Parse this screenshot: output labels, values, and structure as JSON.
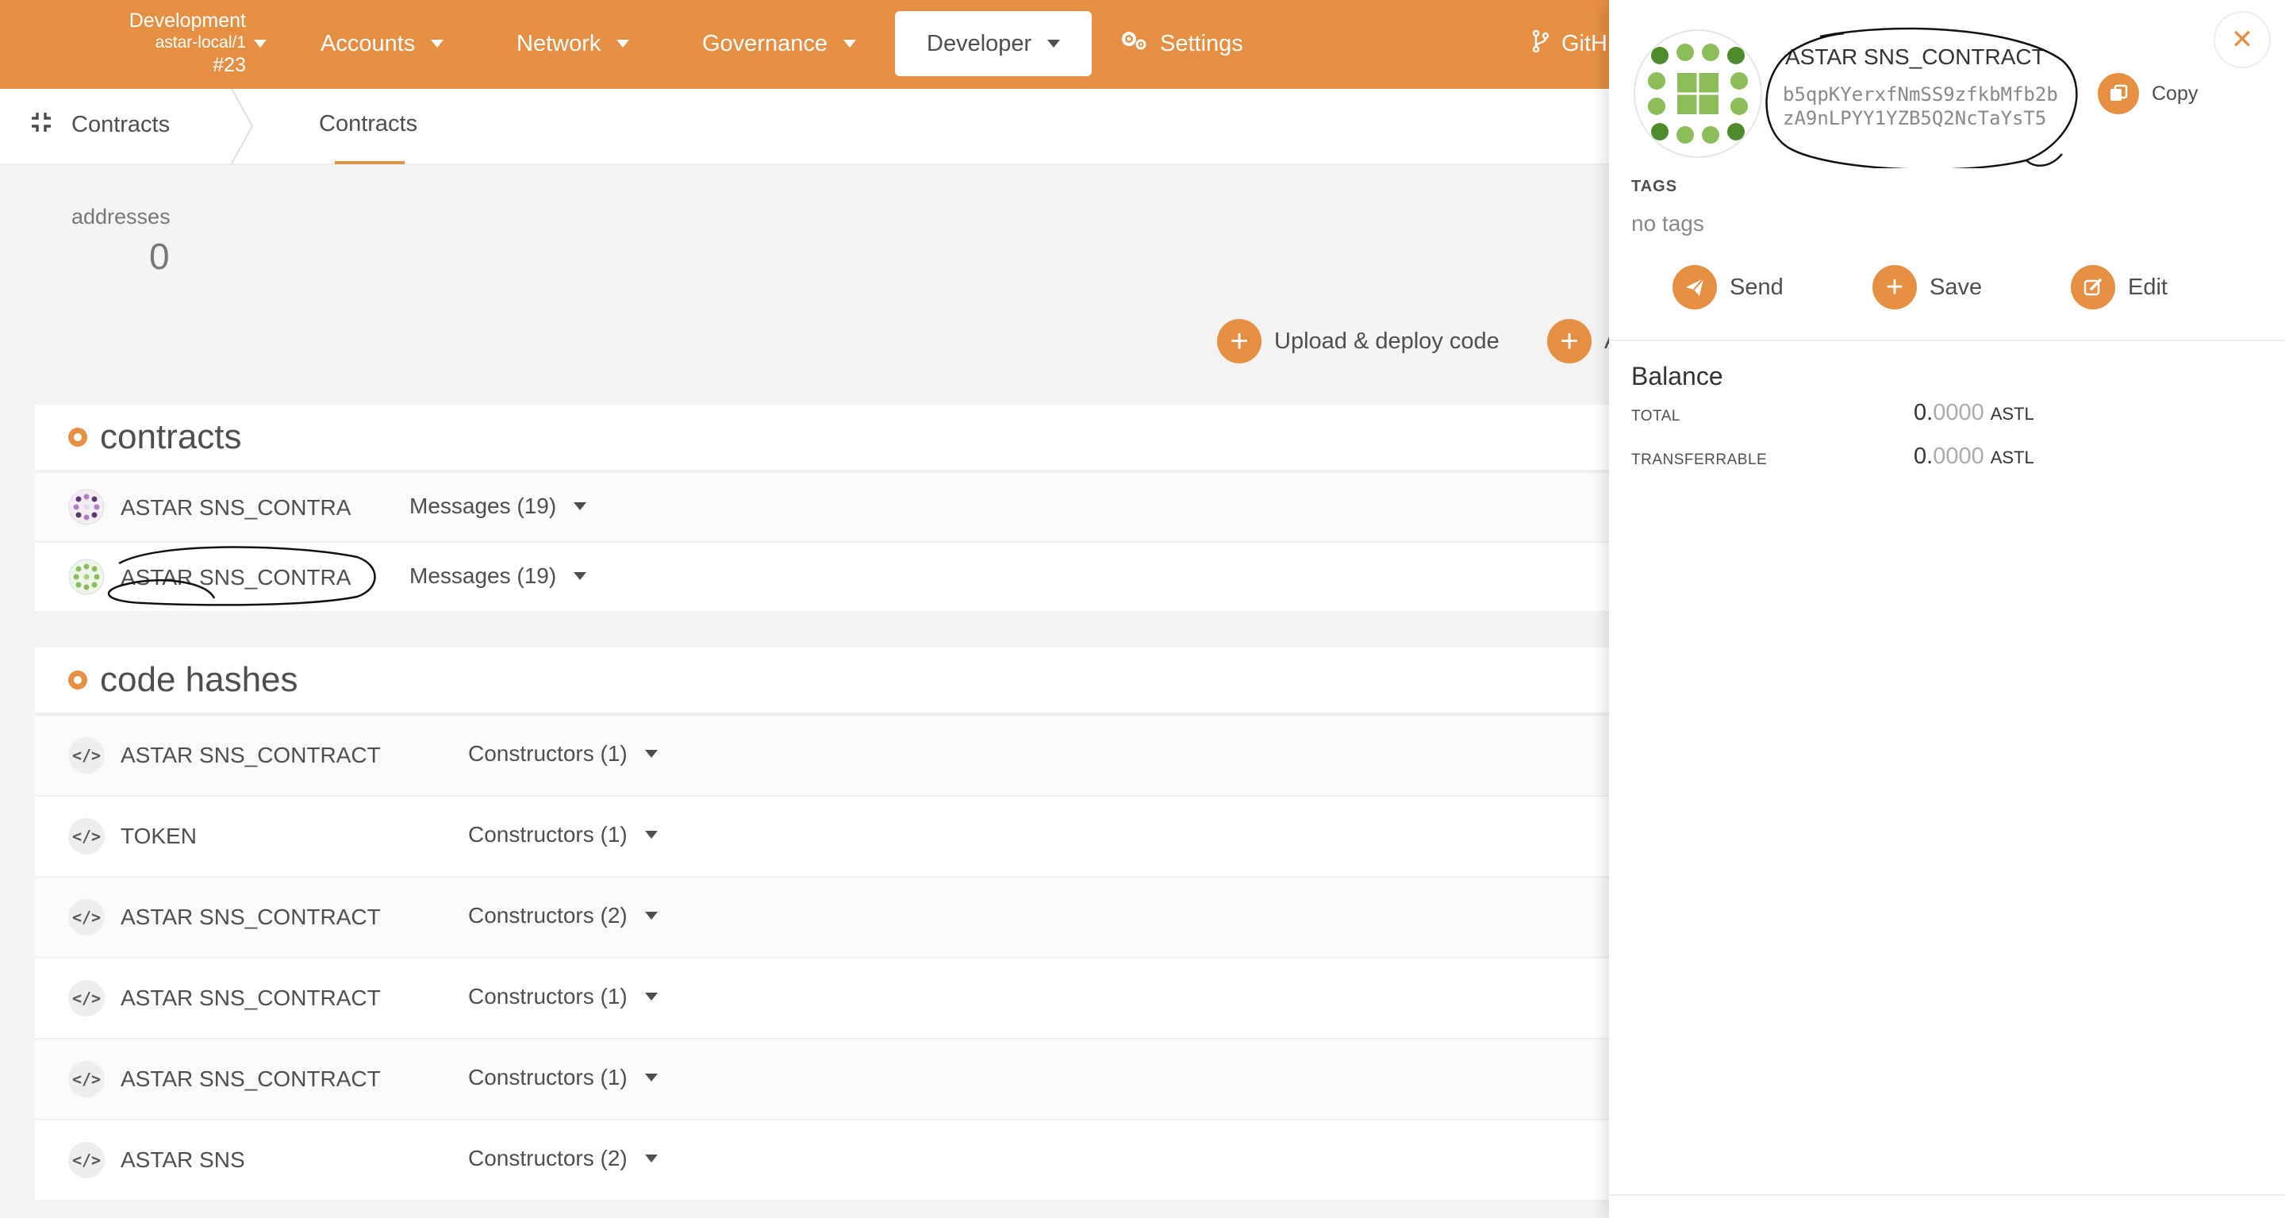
{
  "topbar": {
    "chain": {
      "network": "Development",
      "node": "astar-local/1",
      "block": "#23"
    },
    "menus": [
      {
        "label": "Accounts"
      },
      {
        "label": "Network"
      },
      {
        "label": "Governance"
      },
      {
        "label": "Developer"
      },
      {
        "label": "Settings"
      },
      {
        "label": "GitH"
      }
    ],
    "accent": "#e58f43"
  },
  "subnav": {
    "root_label": "Contracts",
    "active_tab": "Contracts"
  },
  "summary": {
    "label": "addresses",
    "value": "0"
  },
  "actions": {
    "upload": "Upload & deploy code",
    "add_partial": "A"
  },
  "contracts": {
    "title": "contracts",
    "rows": [
      {
        "name": "ASTAR SNS_CONTRA",
        "messages": "Messages (19)"
      },
      {
        "name": "ASTAR SNS_CONTRA",
        "messages": "Messages (19)"
      }
    ]
  },
  "code_hashes": {
    "title": "code hashes",
    "rows": [
      {
        "name": "ASTAR SNS_CONTRACT",
        "constructors": "Constructors (1)"
      },
      {
        "name": "TOKEN",
        "constructors": "Constructors (1)"
      },
      {
        "name": "ASTAR SNS_CONTRACT",
        "constructors": "Constructors (2)"
      },
      {
        "name": "ASTAR SNS_CONTRACT",
        "constructors": "Constructors (1)"
      },
      {
        "name": "ASTAR SNS_CONTRACT",
        "constructors": "Constructors (1)"
      },
      {
        "name": "ASTAR SNS",
        "constructors": "Constructors (2)"
      }
    ]
  },
  "panel": {
    "account_name": "ASTAR SNS_CONTRACT",
    "address": "b5qpKYerxfNmSS9zfkbMfb2bzA9nLPYY1YZB5Q2NcTaYsT5",
    "copy_label": "Copy",
    "tags_label": "TAGS",
    "tags_value": "no tags",
    "buttons": {
      "send": "Send",
      "save": "Save",
      "edit": "Edit"
    },
    "balance_title": "Balance",
    "balances": [
      {
        "label": "TOTAL",
        "int": "0.",
        "dec": "0000",
        "unit": "ASTL"
      },
      {
        "label": "TRANSFERRABLE",
        "int": "0.",
        "dec": "0000",
        "unit": "ASTL"
      }
    ],
    "close_icon": "close-icon"
  }
}
